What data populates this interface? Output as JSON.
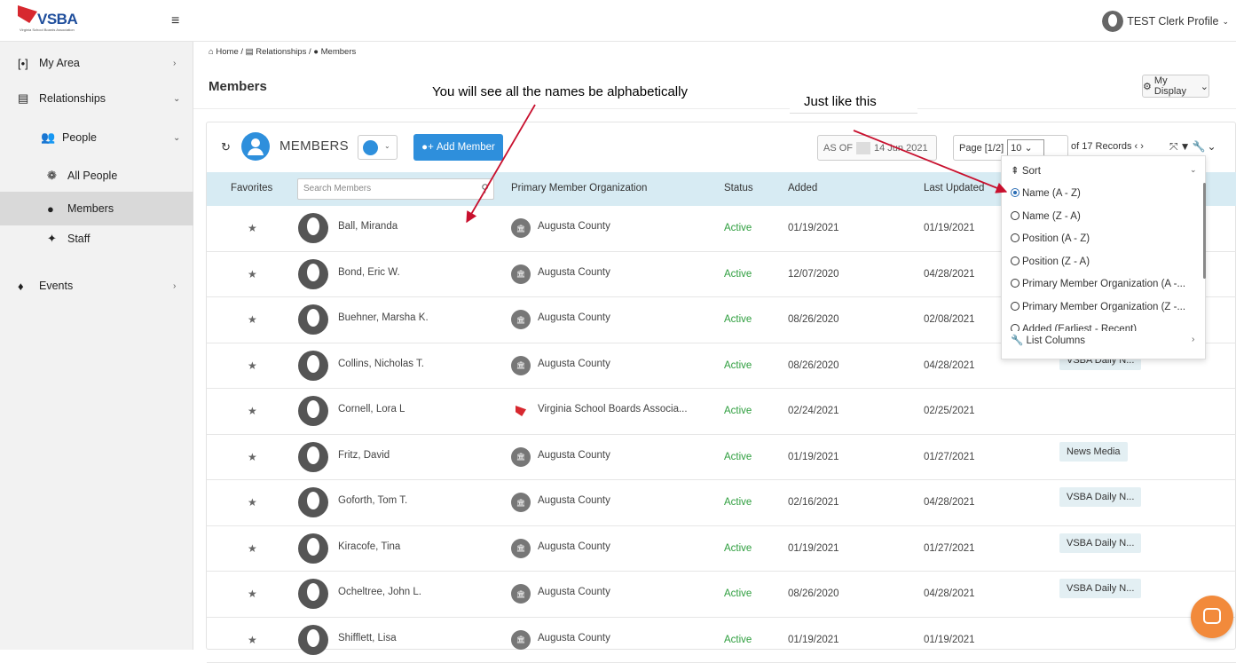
{
  "header": {
    "logo_text": "VSBA",
    "logo_sub": "Virginia School Boards Association",
    "profile_name": "TEST Clerk Profile"
  },
  "sidebar": {
    "items": [
      {
        "label": "My Area"
      },
      {
        "label": "Relationships"
      },
      {
        "label": "People"
      },
      {
        "label": "All People"
      },
      {
        "label": "Members"
      },
      {
        "label": "Staff"
      },
      {
        "label": "Events"
      }
    ]
  },
  "breadcrumb": {
    "home": "Home",
    "relationships": "Relationships",
    "members": "Members"
  },
  "page": {
    "title": "Members",
    "my_display": "My Display"
  },
  "toolbar": {
    "title": "MEMBERS",
    "add_label": "Add Member",
    "asof_label": "AS OF",
    "asof_date": "14 Jun 2021",
    "page_label": "Page [1/2]",
    "page_size": "10",
    "records": "of 17 Records"
  },
  "table": {
    "headers": {
      "favorites": "Favorites",
      "search_placeholder": "Search Members",
      "org": "Primary Member Organization",
      "status": "Status",
      "added": "Added",
      "updated": "Last Updated"
    },
    "rows": [
      {
        "name": "Ball, Miranda",
        "org": "Augusta County",
        "status": "Active",
        "added": "01/19/2021",
        "updated": "01/19/2021",
        "tag": ""
      },
      {
        "name": "Bond, Eric W.",
        "org": "Augusta County",
        "status": "Active",
        "added": "12/07/2020",
        "updated": "04/28/2021",
        "tag": ""
      },
      {
        "name": "Buehner, Marsha K.",
        "org": "Augusta County",
        "status": "Active",
        "added": "08/26/2020",
        "updated": "02/08/2021",
        "tag": ""
      },
      {
        "name": "Collins, Nicholas T.",
        "org": "Augusta County",
        "status": "Active",
        "added": "08/26/2020",
        "updated": "04/28/2021",
        "tag": "VSBA Daily N..."
      },
      {
        "name": "Cornell, Lora L",
        "org": "Virginia School Boards Associa...",
        "status": "Active",
        "added": "02/24/2021",
        "updated": "02/25/2021",
        "tag": ""
      },
      {
        "name": "Fritz, David",
        "org": "Augusta County",
        "status": "Active",
        "added": "01/19/2021",
        "updated": "01/27/2021",
        "tag": "News Media"
      },
      {
        "name": "Goforth, Tom T.",
        "org": "Augusta County",
        "status": "Active",
        "added": "02/16/2021",
        "updated": "04/28/2021",
        "tag": "VSBA Daily N..."
      },
      {
        "name": "Kiracofe, Tina",
        "org": "Augusta County",
        "status": "Active",
        "added": "01/19/2021",
        "updated": "01/27/2021",
        "tag": "VSBA Daily N..."
      },
      {
        "name": "Ocheltree, John L.",
        "org": "Augusta County",
        "status": "Active",
        "added": "08/26/2020",
        "updated": "04/28/2021",
        "tag": "VSBA Daily N..."
      },
      {
        "name": "Shifflett, Lisa",
        "org": "Augusta County",
        "status": "Active",
        "added": "01/19/2021",
        "updated": "01/19/2021",
        "tag": ""
      }
    ]
  },
  "sort_menu": {
    "title": "Sort",
    "options": [
      "Name (A - Z)",
      "Name (Z - A)",
      "Position (A - Z)",
      "Position (Z - A)",
      "Primary Member Organization (A -...",
      "Primary Member Organization (Z -...",
      "Added (Earliest - Recent)"
    ],
    "footer": "List Columns"
  },
  "annotations": {
    "left": "You will see all the names be alphabetically",
    "right": "Just like this"
  },
  "colors": {
    "accent": "#2e8fdc",
    "active": "#2e9e3e",
    "arrow": "#c8102e",
    "header_bg": "#d7ebf3",
    "chat": "#f28a3b"
  }
}
